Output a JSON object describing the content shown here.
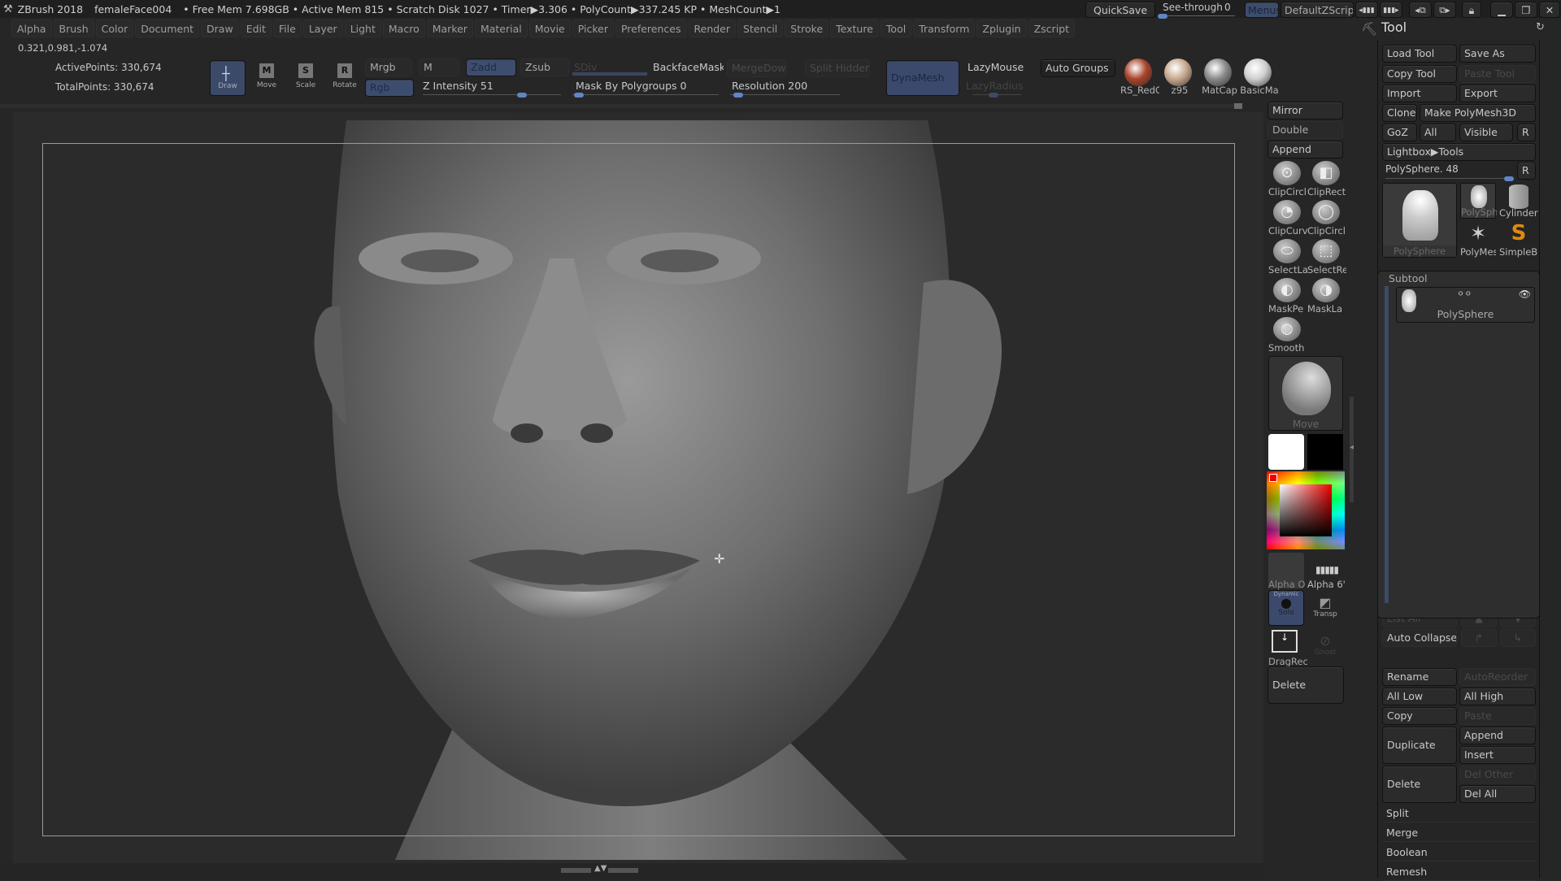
{
  "titlebar": {
    "app": "ZBrush 2018",
    "document": "femaleFace004",
    "stats": "• Free Mem 7.698GB • Active Mem 815 • Scratch Disk 1027 • Timer▶3.306 • PolyCount▶337.245 KP • MeshCount▶1",
    "quicksave": "QuickSave",
    "seethrough_label": "See-through",
    "seethrough_value": "0",
    "menus": "Menus",
    "default_zscript": "DefaultZScript"
  },
  "menubar": [
    "Alpha",
    "Brush",
    "Color",
    "Document",
    "Draw",
    "Edit",
    "File",
    "Layer",
    "Light",
    "Macro",
    "Marker",
    "Material",
    "Movie",
    "Picker",
    "Preferences",
    "Render",
    "Stencil",
    "Stroke",
    "Texture",
    "Tool",
    "Transform",
    "Zplugin",
    "Zscript"
  ],
  "coords": "0.321,0.981,-1.074",
  "stats": {
    "active_points": "ActivePoints: 330,674",
    "total_points": "TotalPoints: 330,674"
  },
  "toolbar": {
    "draw": "Draw",
    "move": "Move",
    "scale": "Scale",
    "rotate": "Rotate",
    "mrgb": "Mrgb",
    "rgb": "Rgb",
    "m": "M",
    "zadd": "Zadd",
    "zsub": "Zsub",
    "z_intensity": "Z Intensity 51",
    "z_intensity_value": 51,
    "sdiv": "SDiv",
    "backface_mask": "BackfaceMask",
    "mask_by_polygroups": "Mask By Polygroups 0",
    "mask_by_polygroups_value": 0,
    "merge_down": "MergeDown",
    "split_hidden": "Split Hidden",
    "resolution": "Resolution 200",
    "resolution_value": 200,
    "dynamesh": "DynaMesh",
    "lazymouse": "LazyMouse",
    "lazyradius": "LazyRadius",
    "auto_groups": "Auto Groups"
  },
  "materials": [
    {
      "name": "RS_RedC",
      "color": "#a8442a"
    },
    {
      "name": "z95",
      "color": "#c7a88e"
    },
    {
      "name": "MatCap",
      "color": "#8a8a8a"
    },
    {
      "name": "BasicMa",
      "color": "#cfcfcf"
    }
  ],
  "right_shelf": {
    "mirror": "Mirror",
    "double": "Double",
    "append": "Append",
    "brushes": [
      "ClipCircl",
      "ClipRect",
      "ClipCurv",
      "ClipCircl",
      "SelectLa",
      "SelectRe",
      "MaskPe",
      "MaskLa",
      "Smooth"
    ],
    "current_brush": "Move",
    "alpha_off": "Alpha O",
    "alpha_6": "Alpha 6'",
    "dynamic": "Dynamic",
    "solo": "Solo",
    "transp": "Transp",
    "dragrect": "DragRec",
    "ghost": "Ghost",
    "delete": "Delete",
    "primary_color": "#ffffff",
    "secondary_color": "#000000"
  },
  "tool_panel": {
    "title": "Tool",
    "load_tool": "Load Tool",
    "save_as": "Save As",
    "copy_tool": "Copy Tool",
    "paste_tool": "Paste Tool",
    "import": "Import",
    "export": "Export",
    "clone": "Clone",
    "make_polymesh": "Make PolyMesh3D",
    "goz": "GoZ",
    "all": "All",
    "visible": "Visible",
    "r": "R",
    "lightbox_tools": "Lightbox▶Tools",
    "current_tool": "PolySphere. 48",
    "tools": [
      "PolySphere",
      "PolySph",
      "Cylinder",
      "PolyMes",
      "SimpleB"
    ],
    "subtool_header": "Subtool",
    "subtool_item": "PolySphere",
    "list_all": "List All",
    "auto_collapse": "Auto Collapse",
    "rename": "Rename",
    "auto_reorder": "AutoReorder",
    "all_low": "All Low",
    "all_high": "All High",
    "copy": "Copy",
    "paste": "Paste",
    "duplicate": "Duplicate",
    "append": "Append",
    "insert": "Insert",
    "delete": "Delete",
    "del_other": "Del Other",
    "del_all": "Del All",
    "split": "Split",
    "merge": "Merge",
    "boolean": "Boolean",
    "remesh": "Remesh"
  }
}
